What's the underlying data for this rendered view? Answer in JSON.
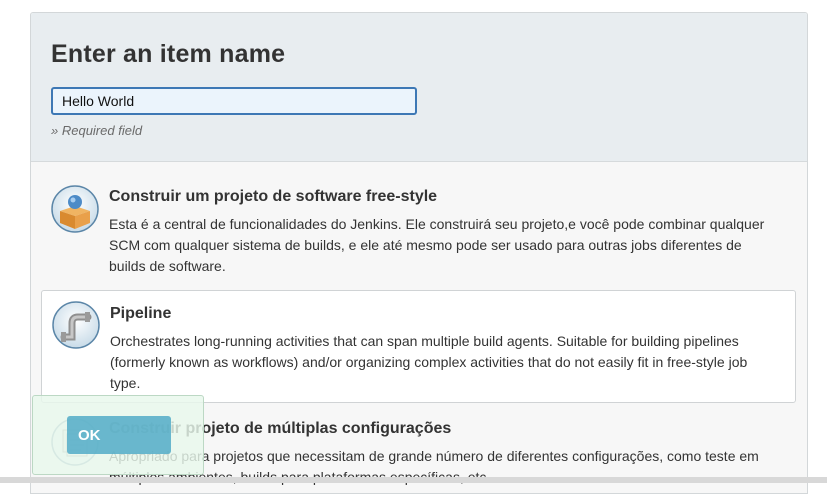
{
  "header": {
    "title": "Enter an item name",
    "name_input_value": "Hello World",
    "required_note": "» Required field"
  },
  "items": [
    {
      "icon": "freestyle-project-icon",
      "title": "Construir um projeto de software free-style",
      "description": "Esta é a central de funcionalidades do Jenkins. Ele construirá seu projeto,e você pode combinar qualquer SCM com qualquer sistema de builds, e ele até mesmo pode ser usado para outras jobs diferentes de builds de software."
    },
    {
      "icon": "pipeline-icon",
      "title": "Pipeline",
      "description": "Orchestrates long-running activities that can span multiple build agents. Suitable for building pipelines (formerly known as workflows) and/or organizing complex activities that do not easily fit in free-style job type.",
      "selected": true
    },
    {
      "icon": "multi-configuration-project-icon",
      "title": "Construir projeto de múltiplas configurações",
      "description": "Apropriado para projetos que necessitam de grande número de diferentes configurações, como teste em múltiplos ambientes, builds para plataformas específicas, etc."
    }
  ],
  "footer": {
    "ok_label": "OK"
  },
  "colors": {
    "header_bg": "#e8edf0",
    "input_border": "#3d78b5",
    "ok_button": "#52acc7"
  }
}
